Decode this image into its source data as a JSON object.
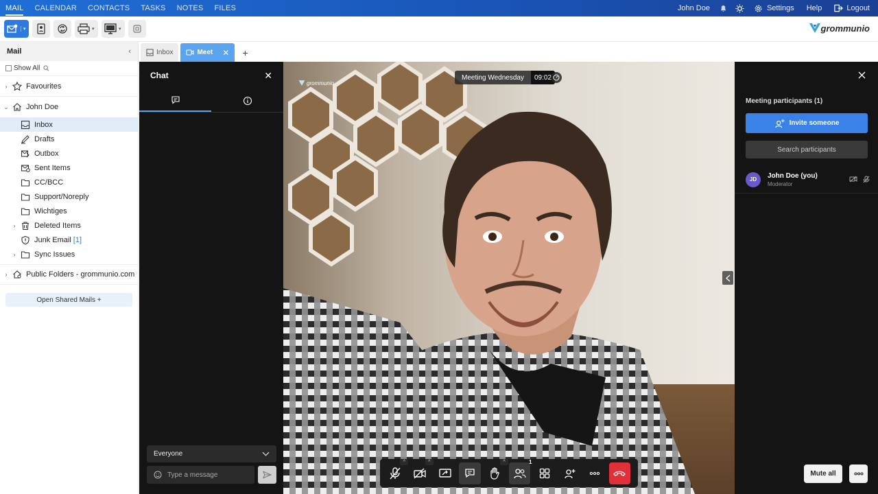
{
  "topnav": {
    "items": [
      "MAIL",
      "CALENDAR",
      "CONTACTS",
      "TASKS",
      "NOTES",
      "FILES"
    ],
    "user": "John Doe",
    "settings": "Settings",
    "help": "Help",
    "logout": "Logout"
  },
  "toolbar": {
    "logo_text": "grommunio"
  },
  "sidebar": {
    "title": "Mail",
    "show_all": "Show All",
    "favourites": "Favourites",
    "account": "John Doe",
    "folders": [
      {
        "label": "Inbox",
        "icon": "inbox-icon"
      },
      {
        "label": "Drafts",
        "icon": "drafts-icon"
      },
      {
        "label": "Outbox",
        "icon": "outbox-icon"
      },
      {
        "label": "Sent Items",
        "icon": "sent-icon"
      },
      {
        "label": "CC/BCC",
        "icon": "folder-icon"
      },
      {
        "label": "Support/Noreply",
        "icon": "folder-icon"
      },
      {
        "label": "Wichtiges",
        "icon": "folder-icon"
      },
      {
        "label": "Deleted Items",
        "icon": "trash-icon"
      },
      {
        "label": "Junk Email",
        "icon": "junk-icon",
        "badge": "[1]"
      },
      {
        "label": "Sync Issues",
        "icon": "folder-icon"
      }
    ],
    "public_folders": "Public Folders - grommunio.com",
    "open_shared": "Open Shared Mails +"
  },
  "tabs": [
    {
      "label": "Inbox"
    },
    {
      "label": "Meet"
    }
  ],
  "chat": {
    "title": "Chat",
    "recipient": "Everyone",
    "placeholder": "Type a message"
  },
  "meeting": {
    "title": "Meeting Wednesday",
    "time": "09:02",
    "watermark": "grommunio",
    "participants_count": "1"
  },
  "participants": {
    "title": "Meeting participants (1)",
    "invite": "Invite someone",
    "search": "Search participants",
    "list": [
      {
        "initials": "JD",
        "name": "John Doe (you)",
        "role": "Moderator"
      }
    ],
    "mute_all": "Mute all"
  },
  "colors": {
    "accent": "#2d7be0",
    "tab_active": "#5aa4ef",
    "hangup": "#e0303a",
    "avatar": "#6a5ac9"
  }
}
